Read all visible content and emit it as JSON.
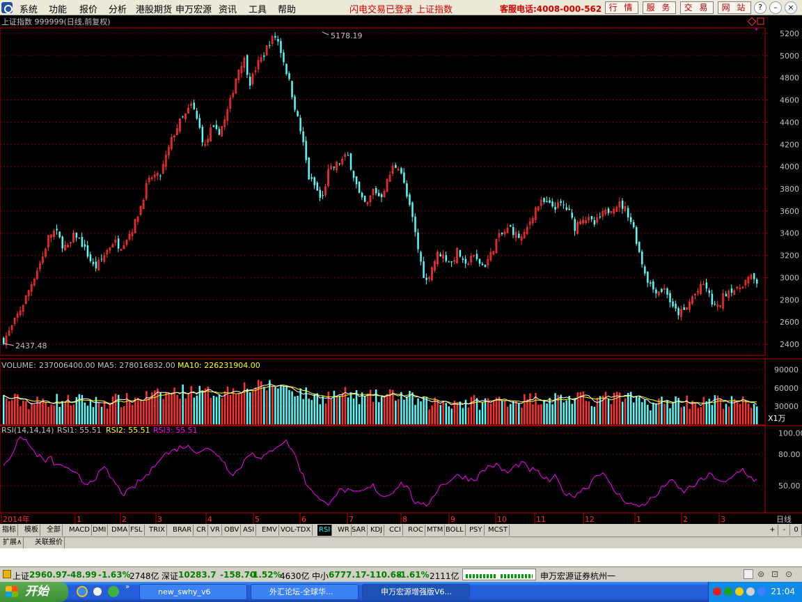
{
  "menu": {
    "items": [
      "系统",
      "功能",
      "报价",
      "分析",
      "港股期货",
      "申万宏源",
      "资讯",
      "工具",
      "帮助"
    ],
    "login_status": "闪电交易已登录",
    "index_name": "上证指数",
    "hotline": "客服电话:4008-000-562",
    "buttons": [
      "行 情",
      "服 务",
      "交 易",
      "网 站"
    ]
  },
  "chart_title": "上证指数 999999(日线,前复权)",
  "volume_legend": {
    "name": "VOLUME:",
    "value": "237006400.00",
    "ma5": "MA5: 278016832.00",
    "ma10": "MA10: 226231904.00"
  },
  "rsi_legend": {
    "name": "RSI(14,14,14)",
    "rsi1": "RSI1: 55.51",
    "rsi2": "RSI2: 55.51",
    "rsi3": "RSI3: 55.51"
  },
  "markers": {
    "high": "5178.19",
    "low": "2437.48"
  },
  "unit_label": "X1万",
  "period_label": "日线",
  "colors": {
    "up": "#ff3232",
    "down": "#54fcfc",
    "grid": "#7a0000",
    "rsi": "#ff00ff",
    "ma10": "#ffff00",
    "axis": "#c0c0c0"
  },
  "chart_data": [
    {
      "type": "candlestick",
      "title": "上证指数 999999(日线,前复权)",
      "ylim": [
        2300,
        5250
      ],
      "yticks": [
        2400,
        2600,
        2800,
        3000,
        3200,
        3400,
        3600,
        3800,
        4000,
        4200,
        4400,
        4600,
        4800,
        5000,
        5200
      ],
      "x_labels": [
        "2014年",
        "1",
        "2",
        "3",
        "4",
        "5",
        "6",
        "7",
        "8",
        "9",
        "10",
        "11",
        "12",
        "1",
        "2",
        "3"
      ],
      "annotations": [
        {
          "text": "5178.19",
          "value": 5178.19
        },
        {
          "text": "2437.48",
          "value": 2437.48
        }
      ],
      "close_path": [
        2437,
        2520,
        2640,
        2760,
        2900,
        3050,
        3180,
        3380,
        3420,
        3300,
        3260,
        3400,
        3310,
        3200,
        3080,
        3150,
        3250,
        3330,
        3280,
        3360,
        3450,
        3620,
        3820,
        3920,
        3900,
        4080,
        4260,
        4390,
        4460,
        4560,
        4380,
        4170,
        4340,
        4300,
        4400,
        4600,
        4850,
        4980,
        4750,
        4910,
        5000,
        5130,
        5178,
        4980,
        4760,
        4500,
        4250,
        3900,
        3820,
        3680,
        3950,
        4000,
        4050,
        4100,
        3900,
        3700,
        3650,
        3800,
        3720,
        3850,
        4000,
        4010,
        3750,
        3520,
        3200,
        2950,
        3100,
        3230,
        3180,
        3130,
        3250,
        3080,
        3200,
        3150,
        3100,
        3200,
        3350,
        3400,
        3450,
        3380,
        3350,
        3500,
        3630,
        3680,
        3650,
        3640,
        3660,
        3600,
        3450,
        3550,
        3520,
        3480,
        3550,
        3600,
        3650,
        3660,
        3600,
        3450,
        3200,
        3000,
        2900,
        2880,
        2900,
        2720,
        2680,
        2700,
        2820,
        2880,
        2950,
        2780,
        2720,
        2850,
        2900,
        2880,
        2960,
        3000,
        2960
      ]
    },
    {
      "type": "bar",
      "title": "VOLUME",
      "ylim": [
        0,
        100000
      ],
      "yticks": [
        30000,
        60000,
        90000
      ],
      "y_unit": "X1万",
      "series": [
        {
          "name": "MA5",
          "value": "278016832.00"
        },
        {
          "name": "MA10",
          "value": "226231904.00"
        }
      ]
    },
    {
      "type": "line",
      "title": "RSI(14,14,14)",
      "ylim": [
        25,
        105
      ],
      "yticks": [
        50.0,
        80.0,
        100.0
      ],
      "series": [
        {
          "name": "RSI1",
          "value": 55.51
        },
        {
          "name": "RSI2",
          "value": 55.51
        },
        {
          "name": "RSI3",
          "value": 55.51
        }
      ],
      "rsi_path": [
        70,
        78,
        90,
        97,
        86,
        80,
        73,
        76,
        68,
        70,
        62,
        60,
        52,
        55,
        60,
        66,
        58,
        48,
        42,
        46,
        53,
        58,
        64,
        76,
        80,
        82,
        86,
        88,
        85,
        83,
        86,
        82,
        80,
        70,
        62,
        65,
        76,
        84,
        74,
        78,
        85,
        90,
        92,
        84,
        68,
        52,
        46,
        36,
        32,
        40,
        45,
        46,
        42,
        44,
        46,
        50,
        42,
        40,
        46,
        52,
        50,
        36,
        30,
        32,
        42,
        50,
        54,
        58,
        60,
        57,
        56,
        62,
        68,
        70,
        66,
        62,
        68,
        72,
        66,
        64,
        60,
        54,
        58,
        48,
        40,
        42,
        46,
        50,
        60,
        64,
        52,
        44,
        38,
        34,
        30,
        32,
        36,
        40,
        48,
        56,
        50,
        44,
        48,
        52,
        56,
        60,
        58,
        52,
        55,
        62,
        66,
        58,
        55
      ]
    }
  ],
  "tabs": [
    "指标",
    "模板",
    "全部",
    "MACD",
    "DMI",
    "DMA",
    "FSL",
    "TRIX",
    "BRAR",
    "CR",
    "VR",
    "OBV",
    "ASI",
    "EMV",
    "VOL-TDX",
    "RSI",
    "WR",
    "SAR",
    "KDJ",
    "CCI",
    "ROC",
    "MTM",
    "BOLL",
    "PSY",
    "MCST"
  ],
  "tabs_right": [
    "+",
    "-",
    "0"
  ],
  "tabs2": [
    "扩展∧",
    "关联报价"
  ],
  "status": {
    "sh_label": "上证",
    "sh_value": "2960.97",
    "sh_change": "-48.99",
    "sh_pct": "-1.63%",
    "sh_amount": "2748亿",
    "sz_label": "深证",
    "sz_value": "10283.7",
    "sz_change": "-158.70",
    "sz_pct": "-1.52%",
    "sz_amount": "4630亿",
    "zx_label": "中小",
    "zx_value": "6777.17",
    "zx_change": "-110.68",
    "zx_pct": "-1.61%",
    "zx_amount": "2111亿",
    "branch": "申万宏源证券杭州一"
  },
  "taskbar": {
    "start": "开始",
    "items": [
      "new_swhy_v6",
      "外汇论坛-全球华...",
      "申万宏源增强版V6..."
    ],
    "time": "21:04"
  }
}
